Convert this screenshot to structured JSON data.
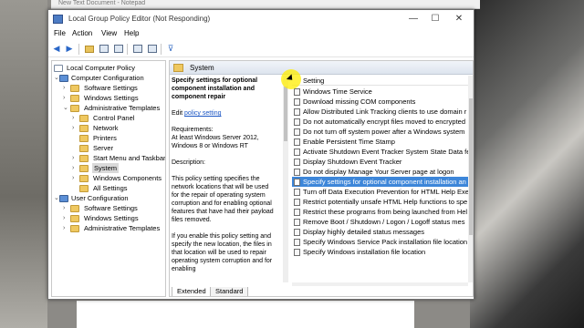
{
  "background": {
    "notepad_title": "New Text Document - Notepad"
  },
  "window": {
    "title": "Local Group Policy Editor (Not Responding)",
    "minimize": "—",
    "maximize": "☐",
    "close": "✕"
  },
  "menu": {
    "file": "File",
    "action": "Action",
    "view": "View",
    "help": "Help"
  },
  "toolbar": {
    "back": "◀",
    "forward": "▶",
    "filter": "⊽"
  },
  "tree": {
    "items": [
      {
        "label": "Local Computer Policy",
        "chev": ""
      },
      {
        "label": "Computer Configuration",
        "chev": "⌄"
      },
      {
        "label": "Software Settings",
        "chev": "›"
      },
      {
        "label": "Windows Settings",
        "chev": "›"
      },
      {
        "label": "Administrative Templates",
        "chev": "⌄"
      },
      {
        "label": "Control Panel",
        "chev": "›"
      },
      {
        "label": "Network",
        "chev": "›"
      },
      {
        "label": "Printers",
        "chev": ""
      },
      {
        "label": "Server",
        "chev": ""
      },
      {
        "label": "Start Menu and Taskbar",
        "chev": "›"
      },
      {
        "label": "System",
        "chev": "›"
      },
      {
        "label": "Windows Components",
        "chev": "›"
      },
      {
        "label": "All Settings",
        "chev": ""
      },
      {
        "label": "User Configuration",
        "chev": "⌄"
      },
      {
        "label": "Software Settings",
        "chev": "›"
      },
      {
        "label": "Windows Settings",
        "chev": "›"
      },
      {
        "label": "Administrative Templates",
        "chev": "›"
      }
    ]
  },
  "content": {
    "header_title": "System",
    "desc": {
      "title": "Specify settings for optional component installation and component repair",
      "edit_prefix": "Edit ",
      "edit_link": "policy setting",
      "requirements_label": "Requirements:",
      "requirements_text": "At least Windows Server 2012, Windows 8 or Windows RT",
      "description_label": "Description:",
      "description_1": "This policy setting specifies the network locations that will be used for the repair of operating system corruption and for enabling optional features that have had their payload files removed.",
      "description_2": "If you enable this policy setting and specify the new location, the files in that location will be used to repair operating system corruption and for enabling"
    },
    "list_header": "Setting",
    "settings": [
      "Windows Time Service",
      "Download missing COM components",
      "Allow Distributed Link Tracking clients to use domain r",
      "Do not automatically encrypt files moved to encrypted",
      "Do not turn off system power after a Windows system",
      "Enable Persistent Time Stamp",
      "Activate Shutdown Event Tracker System State Data fea",
      "Display Shutdown Event Tracker",
      "Do not display Manage Your Server page at logon",
      "Specify settings for optional component installation an",
      "Turn off Data Execution Prevention for HTML Help Exe",
      "Restrict potentially unsafe HTML Help functions to spe",
      "Restrict these programs from being launched from Hel",
      "Remove Boot / Shutdown / Logon / Logoff status mes",
      "Display highly detailed status messages",
      "Specify Windows Service Pack installation file location",
      "Specify Windows installation file location"
    ],
    "selected_index": 9,
    "tabs": {
      "extended": "Extended",
      "standard": "Standard"
    }
  },
  "colors": {
    "selection": "#3d86d9",
    "link": "#1a55c4",
    "cursor_highlight": "#ffee00"
  }
}
